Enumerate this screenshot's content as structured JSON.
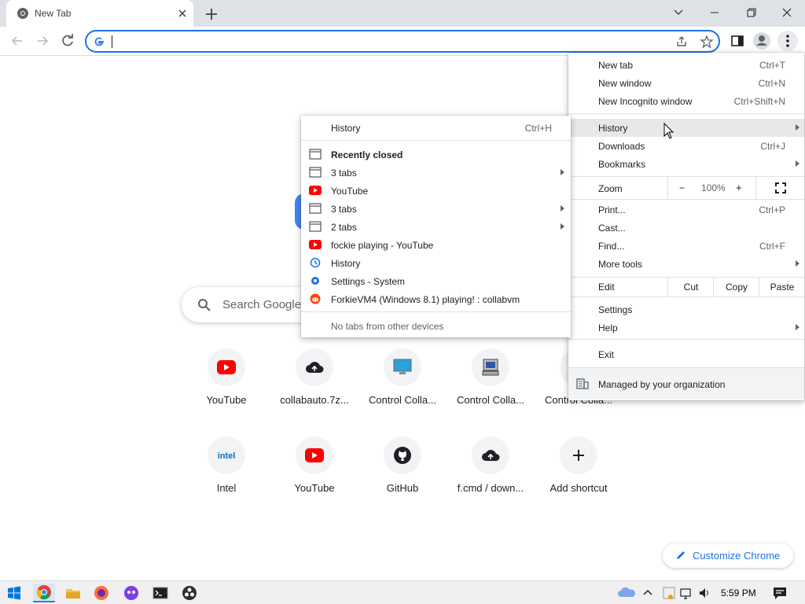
{
  "browser": {
    "tab": {
      "title": "New Tab"
    },
    "omnibox": {
      "value": "",
      "placeholder": ""
    }
  },
  "ntp": {
    "search_placeholder": "Search Google",
    "shortcuts": [
      {
        "label": "YouTube",
        "icon": "youtube-icon"
      },
      {
        "label": "collabauto.7z...",
        "icon": "cloud-upload-icon"
      },
      {
        "label": "Control Colla...",
        "icon": "monitor-icon"
      },
      {
        "label": "Control Colla...",
        "icon": "computer-icon"
      },
      {
        "label": "Control Colla...",
        "icon": "globe-icon"
      },
      {
        "label": "Intel",
        "icon": "intel-icon"
      },
      {
        "label": "YouTube",
        "icon": "youtube-icon"
      },
      {
        "label": "GitHub",
        "icon": "github-icon"
      },
      {
        "label": "f.cmd / down...",
        "icon": "cloud-upload-icon"
      },
      {
        "label": "Add shortcut",
        "icon": "plus-icon"
      }
    ],
    "customize_label": "Customize Chrome"
  },
  "main_menu": {
    "items": [
      {
        "label": "New tab",
        "shortcut": "Ctrl+T"
      },
      {
        "label": "New window",
        "shortcut": "Ctrl+N"
      },
      {
        "label": "New Incognito window",
        "shortcut": "Ctrl+Shift+N"
      },
      {
        "label": "History",
        "shortcut": ""
      },
      {
        "label": "Downloads",
        "shortcut": "Ctrl+J"
      },
      {
        "label": "Bookmarks",
        "shortcut": ""
      },
      {
        "label": "Print...",
        "shortcut": "Ctrl+P"
      },
      {
        "label": "Cast...",
        "shortcut": ""
      },
      {
        "label": "Find...",
        "shortcut": "Ctrl+F"
      },
      {
        "label": "More tools",
        "shortcut": ""
      },
      {
        "label": "Settings",
        "shortcut": ""
      },
      {
        "label": "Help",
        "shortcut": ""
      },
      {
        "label": "Exit",
        "shortcut": ""
      },
      {
        "label": "Managed by your organization",
        "shortcut": ""
      }
    ],
    "zoom": {
      "label": "Zoom",
      "minus": "−",
      "value": "100%",
      "plus": "+"
    },
    "edit": {
      "label": "Edit",
      "cut": "Cut",
      "copy": "Copy",
      "paste": "Paste"
    }
  },
  "history_menu": {
    "history_label": "History",
    "history_shortcut": "Ctrl+H",
    "recently_closed": "Recently closed",
    "items": [
      {
        "label": "3 tabs",
        "icon": "window-icon"
      },
      {
        "label": "YouTube",
        "icon": "youtube-icon"
      },
      {
        "label": "3 tabs",
        "icon": "window-icon"
      },
      {
        "label": "2 tabs",
        "icon": "window-icon"
      },
      {
        "label": "fockie playing - YouTube",
        "icon": "youtube-icon"
      },
      {
        "label": "History",
        "icon": "history-icon"
      },
      {
        "label": "Settings - System",
        "icon": "settings-icon"
      },
      {
        "label": "ForkieVM4 (Windows 8.1) playing! : collabvm",
        "icon": "reddit-icon"
      }
    ],
    "no_tabs": "No tabs from other devices"
  },
  "taskbar": {
    "time": "5:59 PM"
  },
  "colors": {
    "accent": "#1a73e8",
    "youtube": "#ff0000",
    "tabstrip": "#dee1e6"
  }
}
